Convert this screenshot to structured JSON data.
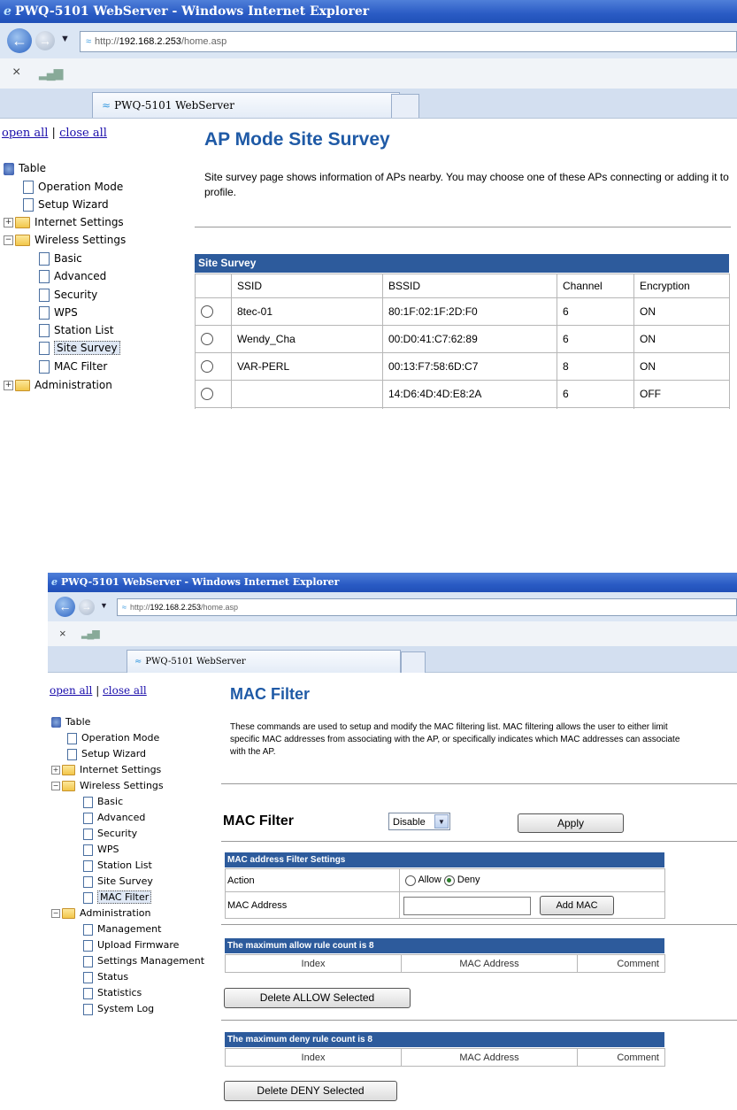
{
  "shot1": {
    "window_title": "PWQ-5101 WebServer - Windows Internet Explorer",
    "address_prefix": "http://",
    "address_host": "192.168.2.253",
    "address_path": "/home.asp",
    "tab_label": "PWQ-5101 WebServer",
    "cmd_stop": "×",
    "links": {
      "open_all": "open all",
      "separator": " | ",
      "close_all": "close all"
    },
    "tree": {
      "root": "Table",
      "operation_mode": "Operation Mode",
      "setup_wizard": "Setup Wizard",
      "internet_settings": "Internet Settings",
      "wireless_settings": "Wireless Settings",
      "basic": "Basic",
      "advanced": "Advanced",
      "security": "Security",
      "wps": "WPS",
      "station_list": "Station List",
      "site_survey": "Site Survey",
      "mac_filter": "MAC Filter",
      "administration": "Administration"
    },
    "page_title": "AP Mode Site Survey",
    "page_desc": "Site survey page shows information of APs nearby. You may choose one of these APs connecting or adding it to profile.",
    "survey": {
      "header": "Site Survey",
      "columns": [
        "SSID",
        "BSSID",
        "Channel",
        "Encryption"
      ],
      "rows": [
        {
          "ssid": "8tec-01",
          "bssid": "80:1F:02:1F:2D:F0",
          "channel": "6",
          "enc": "ON"
        },
        {
          "ssid": "Wendy_Cha",
          "bssid": "00:D0:41:C7:62:89",
          "channel": "6",
          "enc": "ON"
        },
        {
          "ssid": "VAR-PERL",
          "bssid": "00:13:F7:58:6D:C7",
          "channel": "8",
          "enc": "ON"
        },
        {
          "ssid": "",
          "bssid": "14:D6:4D:4D:E8:2A",
          "channel": "6",
          "enc": "OFF"
        }
      ]
    }
  },
  "shot2": {
    "window_title": "PWQ-5101 WebServer - Windows Internet Explorer",
    "address_prefix": "http://",
    "address_host": "192.168.2.253",
    "address_path": "/home.asp",
    "tab_label": "PWQ-5101 WebServer",
    "cmd_stop": "×",
    "links": {
      "open_all": "open all",
      "separator": " | ",
      "close_all": "close all"
    },
    "tree": {
      "root": "Table",
      "operation_mode": "Operation Mode",
      "setup_wizard": "Setup Wizard",
      "internet_settings": "Internet Settings",
      "wireless_settings": "Wireless Settings",
      "basic": "Basic",
      "advanced": "Advanced",
      "security": "Security",
      "wps": "WPS",
      "station_list": "Station List",
      "site_survey": "Site Survey",
      "mac_filter": "MAC Filter",
      "administration": "Administration",
      "management": "Management",
      "upload_firmware": "Upload Firmware",
      "settings_management": "Settings Management",
      "status": "Status",
      "statistics": "Statistics",
      "system_log": "System Log"
    },
    "page_title": "MAC Filter",
    "page_desc": "These commands are used to setup and modify the MAC filtering list. MAC filtering allows the user to either limit specific MAC addresses from associating with the AP, or specifically indicates which MAC addresses can associate with the AP.",
    "mac_filter_label": "MAC Filter",
    "mac_filter_value": "Disable",
    "apply_label": "Apply",
    "settings_header": "MAC address Filter Settings",
    "action_label": "Action",
    "allow_label": "Allow",
    "deny_label": "Deny",
    "mac_address_label": "MAC Address",
    "mac_address_value": "",
    "add_mac_label": "Add MAC",
    "allow_header": "The maximum allow rule count is 8",
    "deny_header": "The maximum deny rule count is 8",
    "list_columns": [
      "Index",
      "MAC Address",
      "Comment"
    ],
    "delete_allow_label": "Delete ALLOW Selected",
    "delete_deny_label": "Delete DENY Selected"
  }
}
